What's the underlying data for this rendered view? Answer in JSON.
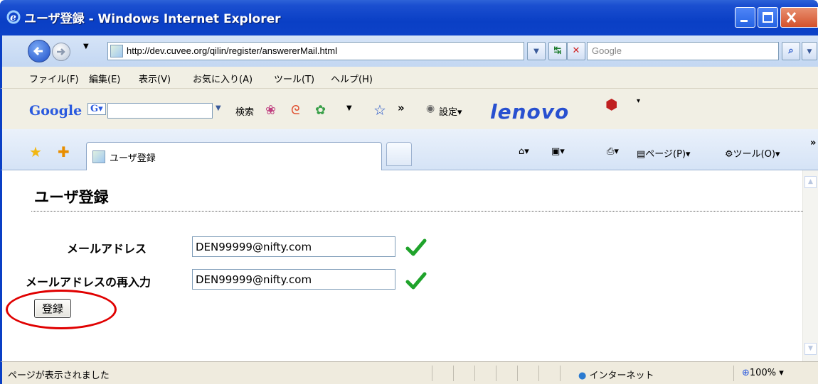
{
  "window": {
    "title": "ユーザ登録 - Windows Internet Explorer"
  },
  "address_bar": {
    "url": "http://dev.cuvee.org/qilin/register/answererMail.html",
    "search_placeholder": "Google"
  },
  "menu": {
    "items": [
      "ファイル(F)",
      "編集(E)",
      "表示(V)",
      "お気に入り(A)",
      "ツール(T)",
      "ヘルプ(H)"
    ]
  },
  "google_toolbar": {
    "logo": "Google",
    "g_button": "G",
    "search_label": "検索",
    "settings_label": "設定",
    "brand": "lenovo",
    "more": "»"
  },
  "tabs": {
    "items": [
      {
        "label": "ユーザ登録"
      }
    ]
  },
  "command_bar": {
    "page_label": "ページ(P)",
    "tools_label": "ツール(O)",
    "more": "»"
  },
  "page": {
    "title": "ユーザ登録",
    "form": {
      "email_label": "メールアドレス",
      "email_value": "DEN99999@nifty.com",
      "email_confirm_label": "メールアドレスの再入力",
      "email_confirm_value": "DEN99999@nifty.com",
      "submit_label": "登録"
    }
  },
  "status_bar": {
    "text": "ページが表示されました",
    "zone": "インターネット",
    "zoom": "100%"
  },
  "colors": {
    "titlebar": "#0a3fc5",
    "check": "#1fa32b",
    "highlight_ring": "#e00000",
    "brand": "#2850d0"
  }
}
